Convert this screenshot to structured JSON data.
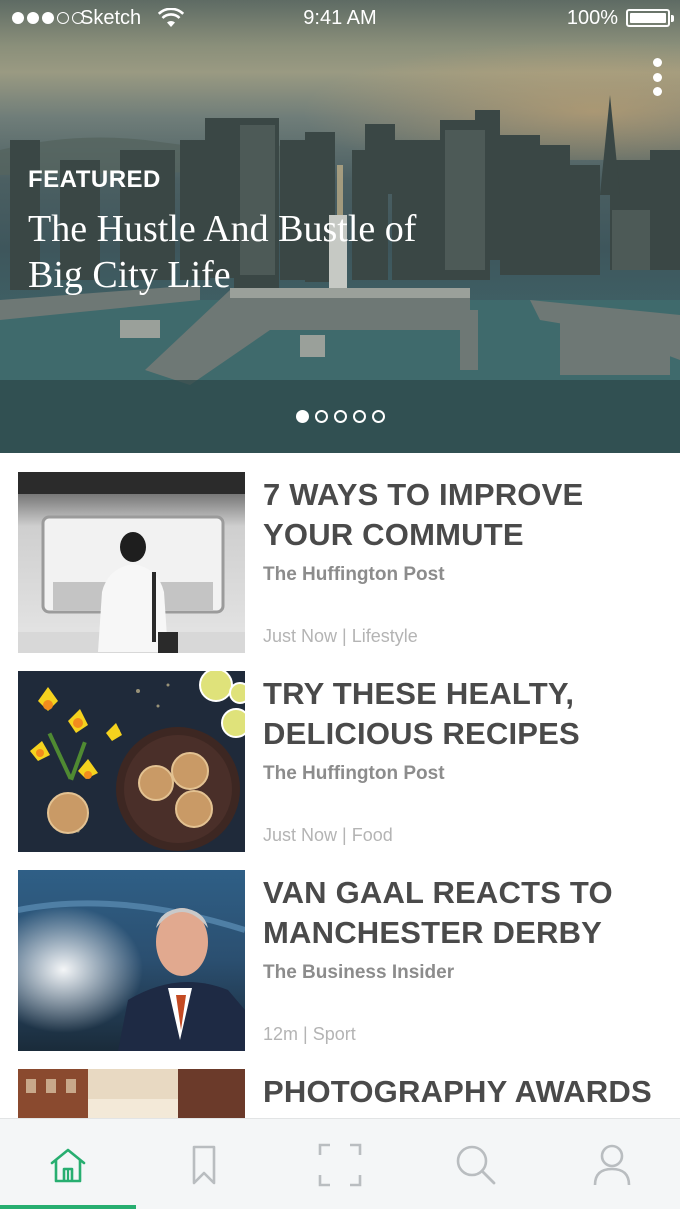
{
  "status_bar": {
    "carrier": "Sketch",
    "time": "9:41 AM",
    "battery": "100%"
  },
  "featured": {
    "label": "FEATURED",
    "title": "The Hustle And Bustle of Big City Life",
    "pager_total": 5,
    "pager_active": 1
  },
  "articles": [
    {
      "title": "7 WAYS TO IMPROVE YOUR COMMUTE",
      "source": "The Huffington Post",
      "meta": "Just Now | Lifestyle"
    },
    {
      "title": "TRY THESE HEALTY, DELICIOUS RECIPES",
      "source": "The Huffington Post",
      "meta": "Just Now | Food"
    },
    {
      "title": "VAN GAAL REACTS TO MANCHESTER DERBY",
      "source": "The Business Insider",
      "meta": "12m | Sport"
    },
    {
      "title": "PHOTOGRAPHY AWARDS",
      "source": "",
      "meta": ""
    }
  ],
  "tab_bar": {
    "tabs": [
      {
        "icon": "home-icon",
        "active": true
      },
      {
        "icon": "bookmark-icon",
        "active": false
      },
      {
        "icon": "frame-icon",
        "active": false
      },
      {
        "icon": "search-icon",
        "active": false
      },
      {
        "icon": "profile-icon",
        "active": false
      }
    ]
  },
  "colors": {
    "accent": "#27ae70",
    "inactive_icon": "#b9bdc0",
    "title_text": "#4a4a4a",
    "source_text": "#8c8c8c",
    "meta_text": "#b4b4b4"
  }
}
